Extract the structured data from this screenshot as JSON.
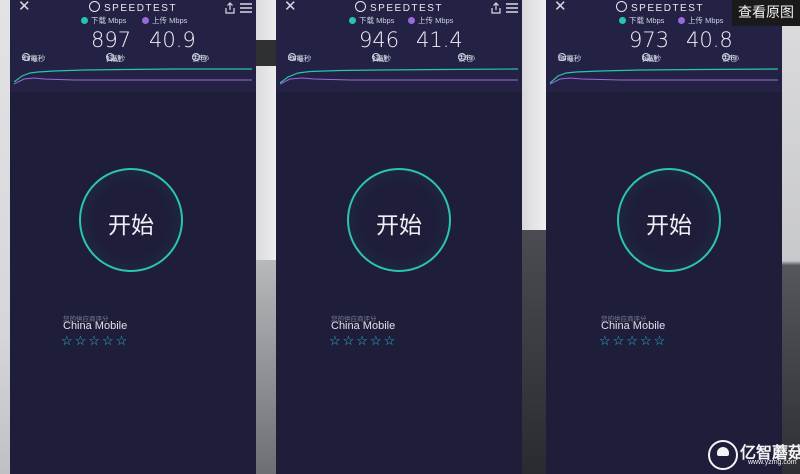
{
  "app": {
    "brand": "SPEEDTEST"
  },
  "labels": {
    "download": "下载 Mbps",
    "upload": "上传 Mbps",
    "ping": "Ping",
    "jitter": "抖动",
    "loss": "丢包",
    "start": "开始",
    "rate_prompt": "您的供应商评分",
    "stars": "☆☆☆☆☆"
  },
  "panels": [
    {
      "download": "897",
      "upload": "40.9",
      "ping": "41毫秒",
      "jitter": "1毫秒",
      "loss": "0.0%",
      "provider": "China Mobile"
    },
    {
      "download": "946",
      "upload": "41.4",
      "ping": "48毫秒",
      "jitter": "1毫秒",
      "loss": "0.0%",
      "provider": "China Mobile"
    },
    {
      "download": "973",
      "upload": "40.8",
      "ping": "50毫秒",
      "jitter": "0毫秒",
      "loss": "0.0%",
      "provider": "China Mobile"
    }
  ],
  "overlay": {
    "view_original": "查看原图",
    "watermark_name": "亿智蘑菇",
    "watermark_url": "www.yzmg.com"
  },
  "colors": {
    "panel_bg": "#1f1e3a",
    "download_accent": "#26c6ad",
    "upload_accent": "#9b69d8",
    "ring": "#2cc4ad",
    "stars": "#2fb6d9"
  },
  "icons": [
    "close-icon",
    "speedtest-logo-icon",
    "share-icon",
    "menu-icon",
    "ping-icon",
    "jitter-icon",
    "loss-icon",
    "star-icon"
  ]
}
